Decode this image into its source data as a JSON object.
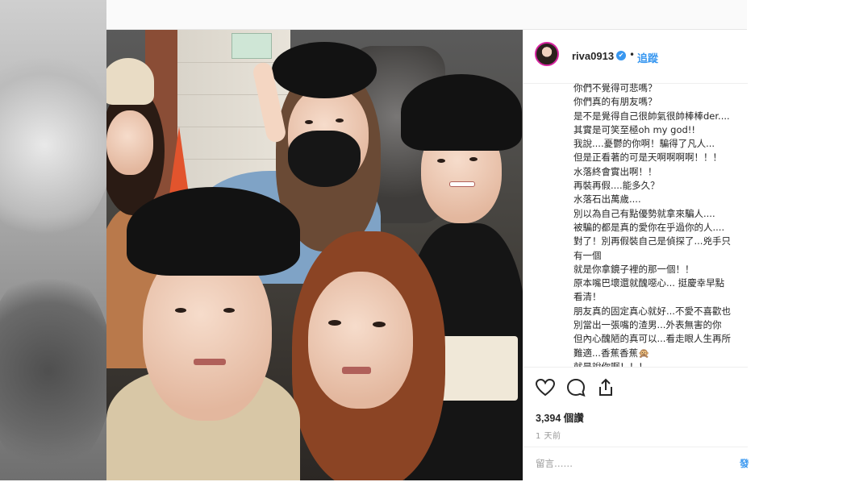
{
  "post": {
    "username": "riva0913",
    "verified_badge": "✔",
    "separator": "•",
    "follow_label": "追蹤",
    "views": "3,394 個讚",
    "time": "1 天前",
    "comment_placeholder": "留言……",
    "post_label": "發"
  },
  "caption_lines": [
    "你們不覺得可悲嗎？",
    "你們真的有朋友嗎？",
    "是不是覺得自己很帥氣很帥棒棒der....",
    "其實是可笑至極oh my god!!",
    "我說....憂鬱的你啊！騙得了凡人...",
    "但是正看著的可是天啊啊啊啊！！！",
    "水落終會實出啊！！",
    "再裝再假....能多久？",
    "水落石出萬歲....",
    "別以為自己有點優勢就拿來騙人....",
    "被騙的都是真的愛你在乎過你的人....",
    "對了！別再假裝自己是偵探了...兇手只",
    "有一個",
    "就是你拿鏡子裡的那一個！！",
    "原本嘴巴壞還就醜噁心... 挺慶幸早點",
    "看清！",
    "朋友真的固定真心就好...不愛不喜歡也",
    "別當出一張嘴的渣男...外表無害的你",
    "但內心醜陋的真可以...看走眼人生再所",
    "難適...香蕉香蕉🙊",
    "就是說你啊！！！"
  ],
  "icons": {
    "like": "heart-icon",
    "comment": "comment-icon",
    "share": "share-icon",
    "next": "chevron-right-icon"
  },
  "carousel": {
    "total": 3,
    "active": 1
  },
  "colors": {
    "accent": "#3897f0",
    "text": "#262626",
    "muted": "#999999"
  }
}
